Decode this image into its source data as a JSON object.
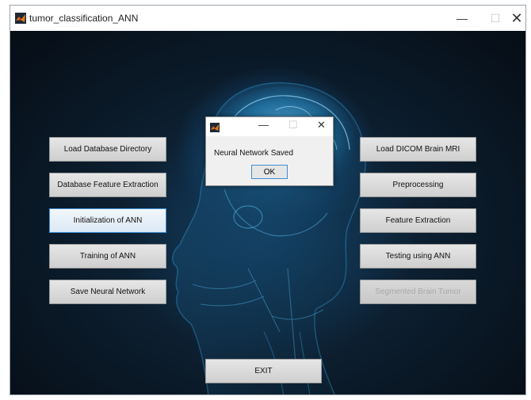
{
  "window": {
    "title": "tumor_classification_ANN",
    "controls": {
      "minimize": "—",
      "maximize": "☐",
      "close": "✕"
    }
  },
  "left_buttons": [
    {
      "label": "Load Database Directory"
    },
    {
      "label": "Database Feature Extraction"
    },
    {
      "label": "Initialization of ANN"
    },
    {
      "label": "Training of ANN"
    },
    {
      "label": "Save Neural Network"
    }
  ],
  "right_buttons": [
    {
      "label": "Load DICOM Brain MRI"
    },
    {
      "label": "Preprocessing"
    },
    {
      "label": "Feature Extraction"
    },
    {
      "label": "Testing using ANN"
    },
    {
      "label": "Segmented Brain Tumor"
    }
  ],
  "exit_button": {
    "label": "EXIT"
  },
  "dialog": {
    "message": "Neural Network Saved",
    "ok_label": "OK",
    "controls": {
      "minimize": "—",
      "maximize": "☐",
      "close": "✕"
    }
  },
  "colors": {
    "accent": "#3c8fd6",
    "background": "#0c1620",
    "brain_glow": "#2a96d2"
  },
  "icons": {
    "app": "matlab-logo-icon"
  }
}
